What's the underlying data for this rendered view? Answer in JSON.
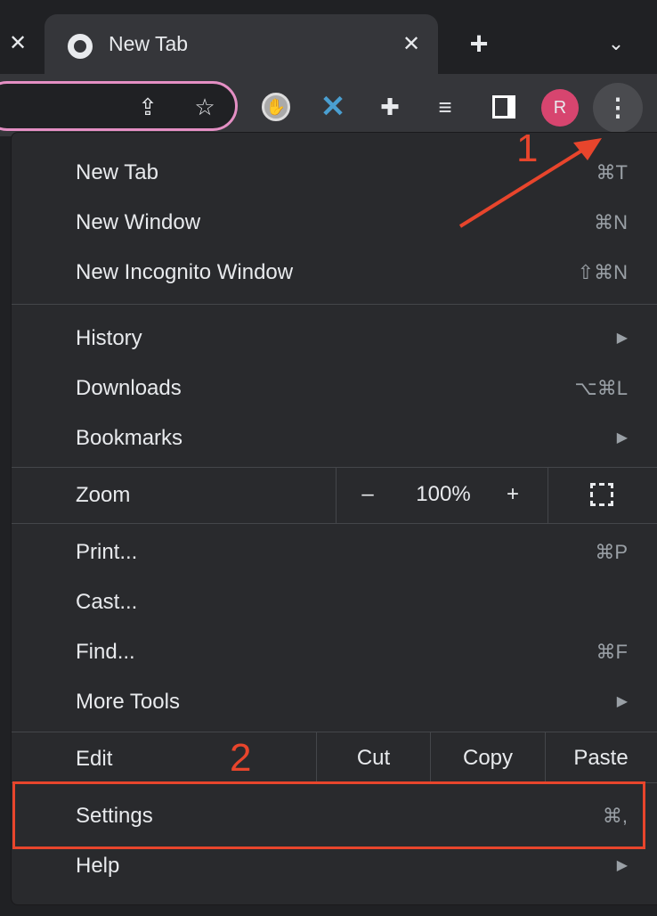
{
  "tabs": {
    "active_title": "New Tab",
    "new_tab": "+",
    "close": "✕"
  },
  "avatar_letter": "R",
  "menu": {
    "group1": [
      {
        "label": "New Tab",
        "shortcut": "⌘T"
      },
      {
        "label": "New Window",
        "shortcut": "⌘N"
      },
      {
        "label": "New Incognito Window",
        "shortcut": "⇧⌘N"
      }
    ],
    "group2": [
      {
        "label": "History",
        "shortcut": "▶"
      },
      {
        "label": "Downloads",
        "shortcut": "⌥⌘L"
      },
      {
        "label": "Bookmarks",
        "shortcut": "▶"
      }
    ],
    "zoom": {
      "label": "Zoom",
      "minus": "–",
      "value": "100%",
      "plus": "+"
    },
    "group3": [
      {
        "label": "Print...",
        "shortcut": "⌘P"
      },
      {
        "label": "Cast...",
        "shortcut": ""
      },
      {
        "label": "Find...",
        "shortcut": "⌘F"
      },
      {
        "label": "More Tools",
        "shortcut": "▶"
      }
    ],
    "edit": {
      "label": "Edit",
      "cut": "Cut",
      "copy": "Copy",
      "paste": "Paste"
    },
    "settings": {
      "label": "Settings",
      "shortcut": "⌘,"
    },
    "help": {
      "label": "Help",
      "shortcut": "▶"
    }
  },
  "annotations": {
    "step1": "1",
    "step2": "2",
    "color": "#e8452c"
  }
}
